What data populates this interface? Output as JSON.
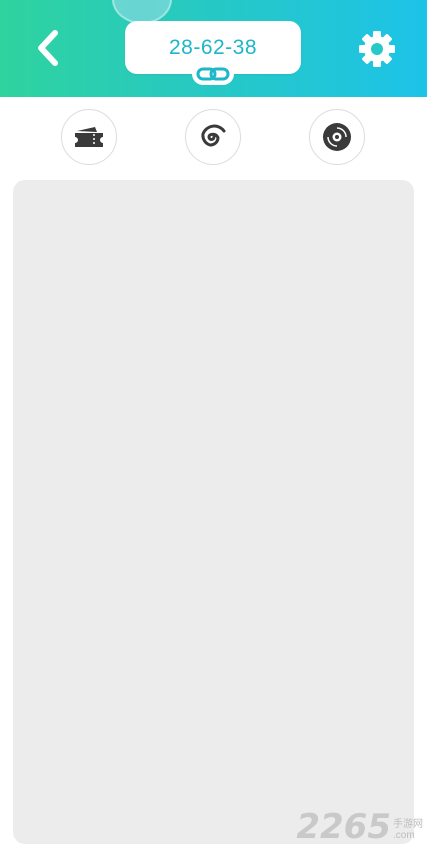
{
  "header": {
    "code": "28-62-38",
    "gradient_start": "#2fd39e",
    "gradient_end": "#1dc3e8",
    "icons": {
      "back": "back-chevron-icon",
      "link": "link-icon",
      "settings": "gear-icon"
    }
  },
  "toolbar": {
    "buttons": [
      {
        "icon": "ticket-icon"
      },
      {
        "icon": "spiral-icon"
      },
      {
        "icon": "disc-icon"
      }
    ]
  },
  "watermark": {
    "number": "2265",
    "cn": "手游网",
    "domain": ".com"
  }
}
